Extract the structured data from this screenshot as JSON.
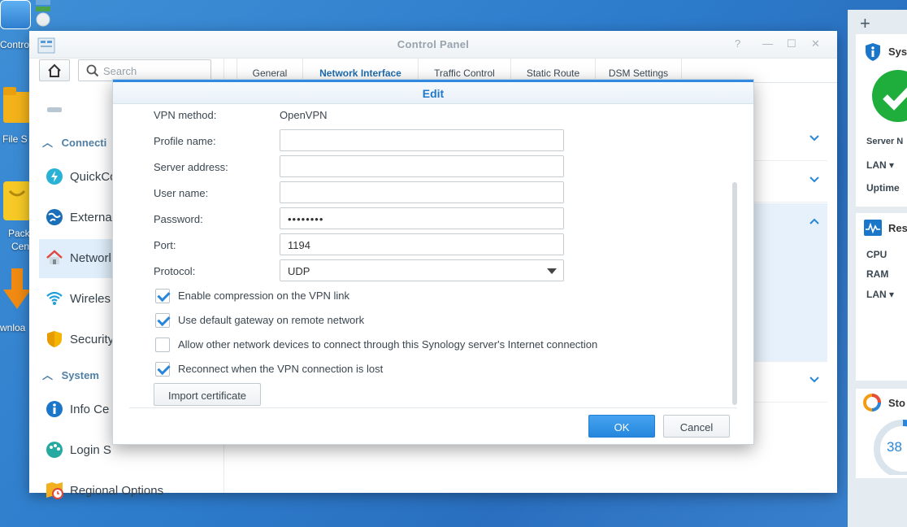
{
  "desktop": {
    "icons": [
      {
        "label": "Contro"
      },
      {
        "label": "File S"
      },
      {
        "label": "Pack"
      },
      {
        "label": "Cen"
      },
      {
        "label": "wnloa"
      }
    ]
  },
  "window": {
    "title": "Control Panel",
    "controls": {
      "help": "?",
      "minimize": "—",
      "maximize": "☐",
      "close": "✕"
    }
  },
  "sidebar": {
    "search_placeholder": "Search",
    "sections": [
      {
        "label": "Connecti"
      },
      {
        "label": "System"
      }
    ],
    "items": [
      {
        "label": "QuickCo"
      },
      {
        "label": "Externa"
      },
      {
        "label": "Networl"
      },
      {
        "label": "Wireles"
      },
      {
        "label": "Security"
      },
      {
        "label": "Info Ce"
      },
      {
        "label": "Login S"
      },
      {
        "label": "Regional Options"
      }
    ]
  },
  "tabs": [
    {
      "label": "General"
    },
    {
      "label": "Network Interface"
    },
    {
      "label": "Traffic Control"
    },
    {
      "label": "Static Route"
    },
    {
      "label": "DSM Settings"
    }
  ],
  "dialog": {
    "title": "Edit",
    "fields": {
      "vpn_method_label": "VPN method:",
      "vpn_method_value": "OpenVPN",
      "profile_name_label": "Profile name:",
      "profile_name_value": "",
      "server_address_label": "Server address:",
      "server_address_value": "",
      "user_name_label": "User name:",
      "user_name_value": "",
      "password_label": "Password:",
      "password_value": "••••••••",
      "port_label": "Port:",
      "port_value": "1194",
      "protocol_label": "Protocol:",
      "protocol_value": "UDP"
    },
    "checkboxes": [
      {
        "label": "Enable compression on the VPN link",
        "checked": true
      },
      {
        "label": "Use default gateway on remote network",
        "checked": true
      },
      {
        "label": "Allow other network devices to connect through this Synology server's Internet connection",
        "checked": false
      },
      {
        "label": "Reconnect when the VPN connection is lost",
        "checked": true
      }
    ],
    "import_button": "Import certificate",
    "ok_button": "OK",
    "cancel_button": "Cancel"
  },
  "widgets": {
    "add": "+",
    "system_title": "Sys",
    "server_label": "Server N",
    "lan_label": "LAN",
    "uptime_label": "Uptime",
    "resource_title": "Res",
    "cpu_label": "CPU",
    "ram_label": "RAM",
    "lan2_label": "LAN",
    "storage_title": "Sto",
    "storage_percent": "38"
  },
  "colors": {
    "accent": "#2a86d8",
    "dialog_title": "#1f78c9",
    "status_ok": "#1fae3c"
  }
}
